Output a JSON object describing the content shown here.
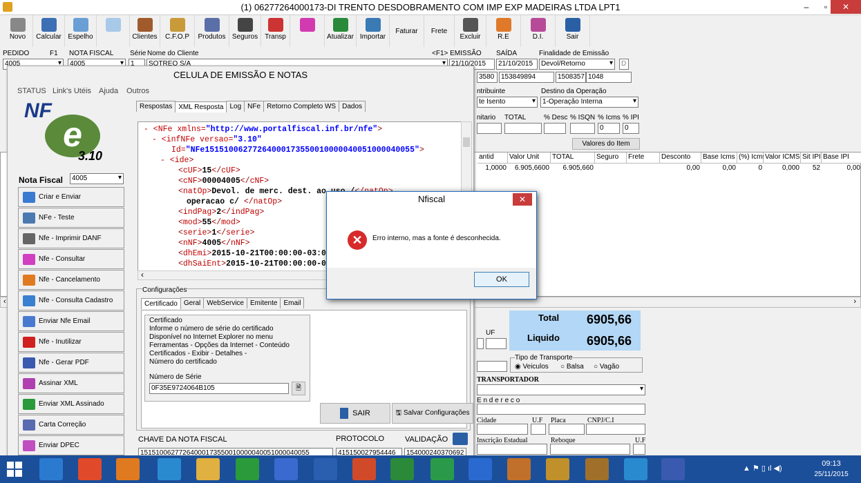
{
  "window": {
    "title": "(1) 06277264000173-DI TRENTO DESDOBRAMENTO COM IMP EXP MADEIRAS LTDA  LPT1",
    "min": "–",
    "max": "▫",
    "close": "✕"
  },
  "toolbar": [
    {
      "label": "Novo",
      "color": "#888"
    },
    {
      "label": "Calcular",
      "color": "#3d6fb5"
    },
    {
      "label": "Espelho",
      "color": "#6a9fd6"
    },
    {
      "label": "",
      "color": "#a8c9e8"
    },
    {
      "label": "Clientes",
      "color": "#a05a2c"
    },
    {
      "label": "C.F.O.P",
      "color": "#c89a3a"
    },
    {
      "label": "Produtos",
      "color": "#5a6fa8"
    },
    {
      "label": "Seguros",
      "color": "#444"
    },
    {
      "label": "Transp",
      "color": "#c33"
    },
    {
      "label": "",
      "color": "#d23ab0"
    },
    {
      "label": "Atualizar",
      "color": "#2a8a3a"
    },
    {
      "label": "Importar",
      "color": "#3a7ab5"
    },
    {
      "label": "Faturar",
      "color": ""
    },
    {
      "label": "Frete",
      "color": ""
    },
    {
      "label": "Excluir",
      "color": "#555"
    },
    {
      "label": "R.E",
      "color": "#e07a2a"
    },
    {
      "label": "D.I.",
      "color": "#b84a9a"
    },
    {
      "label": "Sair",
      "color": "#2a5fa5"
    }
  ],
  "header": {
    "labels": {
      "pedido": "PEDIDO",
      "f1": "F1",
      "nota": "NOTA FISCAL",
      "serie": "Série",
      "cliente": "Nome do Cliente",
      "emissao": "<F1> EMISSÃO",
      "saida": "SAÍDA",
      "finalidade": "Finalidade de Emissão"
    },
    "values": {
      "pedido": "4005",
      "nota": "4005",
      "serie": "1",
      "cliente": "SOTREQ S/A",
      "emissao": "21/10/2015",
      "saida": "21/10/2015",
      "finalidade": "Devol/Retorno",
      "flag": "D"
    },
    "row2": [
      "3580",
      "153849894",
      "1508357",
      "1048"
    ],
    "contrib_label": "ntribuinte",
    "contrib": "te Isento",
    "destino_label": "Destino da Operação",
    "destino": "1-Operação Interna",
    "cols": [
      "nitario",
      "TOTAL",
      "% Desc",
      "% ISQN",
      "% Icms",
      "% IPI"
    ],
    "icms": "0",
    "ipi": "0",
    "valores_btn": "Valores do Item"
  },
  "itemgrid": {
    "headers": [
      "antid",
      "Valor Unit",
      "TOTAL",
      "Seguro",
      "Frete",
      "Desconto",
      "Base Icms",
      "(%) Icms",
      "Valor ICMS",
      "Sit IPI",
      "Base IPI"
    ],
    "row": [
      "1,0000",
      "6.905,6600",
      "6.905,660",
      "",
      "",
      "0,00",
      "0,00",
      "0",
      "0,000",
      "52",
      "0,00"
    ]
  },
  "totals": {
    "total_label": "Total",
    "total": "6905,66",
    "liquido_label": "Liquido",
    "liquido": "6905,66",
    "uf": "UF"
  },
  "transporte": {
    "label": "Tipo de Transporte",
    "options": [
      "Veiculos",
      "Balsa",
      "Vagão"
    ],
    "transportador": "TRANSPORTADOR",
    "endereco": "E n d e r e c o",
    "cidade": "Cidade",
    "uf": "U.F",
    "placa": "Placa",
    "cnpj": "CNPJ/C.I",
    "ie": "Inscrição Estadual",
    "reboque": "Reboque",
    "uf2": "U.F"
  },
  "panel": {
    "title": "CELULA DE EMISSÃO E NOTAS",
    "menu": [
      "STATUS",
      "Link's Utéis",
      "Ajuda",
      "Outros"
    ],
    "logo": {
      "nf": "NF",
      "e": "e",
      "ver": "3.10"
    },
    "nota_label": "Nota Fiscal",
    "nota_value": "4005",
    "buttons": [
      {
        "label": "Criar e Enviar",
        "color": "#3a7ad0"
      },
      {
        "label": "NFe - Teste",
        "color": "#4a7ab0"
      },
      {
        "label": "Nfe - Imprimir DANF",
        "color": "#666"
      },
      {
        "label": "Nfe - Consultar",
        "color": "#d040c0"
      },
      {
        "label": "Nfe - Cancelamento",
        "color": "#e07a20"
      },
      {
        "label": "Nfe - Consulta Cadastro",
        "color": "#3a80d0"
      },
      {
        "label": "Enviar Nfe Email",
        "color": "#4a7ad0"
      },
      {
        "label": "Nfe - Inutilizar",
        "color": "#d02020"
      },
      {
        "label": "Nfe - Gerar PDF",
        "color": "#3a5ab0"
      },
      {
        "label": "Assinar XML",
        "color": "#b040b0"
      },
      {
        "label": "Enviar XML Assinado",
        "color": "#2a9a3a"
      },
      {
        "label": "Carta Correção",
        "color": "#5a6ab0"
      },
      {
        "label": "Enviar DPEC",
        "color": "#c050c0"
      }
    ],
    "tabs": [
      "Respostas",
      "XML Resposta",
      "Log",
      "NFe",
      "Retorno Completo WS",
      "Dados"
    ],
    "xml": [
      {
        "pre": "- <",
        "tag": "NFe",
        "attr": " xmlns=",
        "val": "\"http://www.portalfiscal.inf.br/nfe\"",
        "post": ">"
      },
      {
        "pre": "- <",
        "tag": "infNFe",
        "attr": " versao=",
        "val": "\"3.10\"",
        "post": ""
      },
      {
        "pre": "",
        "tag": "",
        "attr": "Id=",
        "val": "\"NFe15151006277264000173550010000040051000040055\"",
        "post": ">"
      },
      {
        "pre": "- <",
        "tag": "ide",
        "attr": "",
        "val": "",
        "post": ">"
      },
      {
        "open": "cUF",
        "text": "15"
      },
      {
        "open": "cNF",
        "text": "00004005"
      },
      {
        "open": "natOp",
        "text": "Devol. de merc. dest. ao uso /"
      },
      {
        "cont": "operacao c/ ",
        "close": "natOp"
      },
      {
        "open": "indPag",
        "text": "2"
      },
      {
        "open": "mod",
        "text": "55"
      },
      {
        "open": "serie",
        "text": "1"
      },
      {
        "open": "nNF",
        "text": "4005"
      },
      {
        "open": "dhEmi",
        "text": "2015-10-21T00:00:00-03:00"
      },
      {
        "open": "dhSaiEnt",
        "text": "2015-10-21T00:00:00-03:00"
      }
    ],
    "config": {
      "title": "Configurações",
      "tabs": [
        "Certificado",
        "Geral",
        "WebService",
        "Emitente",
        "Email"
      ],
      "cert_title": "Certificado",
      "cert_text": [
        "Informe o número de série do certificado",
        "Disponível no Internet Explorer no menu",
        "Ferramentas - Opções da Internet - Conteúdo",
        "Certificados - Exibir - Detalhes -",
        "Número do certificado"
      ],
      "serie_label": "Número de Série",
      "serie_value": "0F35E9724064B105",
      "sair": "SAIR",
      "salvar": "Salvar Configurações"
    },
    "chave_label": "CHAVE DA NOTA FISCAL",
    "chave": "15151006277264000173550010000040051000040055",
    "protocolo_label": "PROTOCOLO",
    "protocolo": "415150027954446",
    "validacao_label": "VALIDAÇÃO",
    "validacao": "154000240370692"
  },
  "dialog": {
    "title": "Nfiscal",
    "message": "Erro interno, mas a fonte é desconhecida.",
    "ok": "OK",
    "close": "✕"
  },
  "taskbar": {
    "time": "09:13",
    "date": "25/11/2015"
  }
}
